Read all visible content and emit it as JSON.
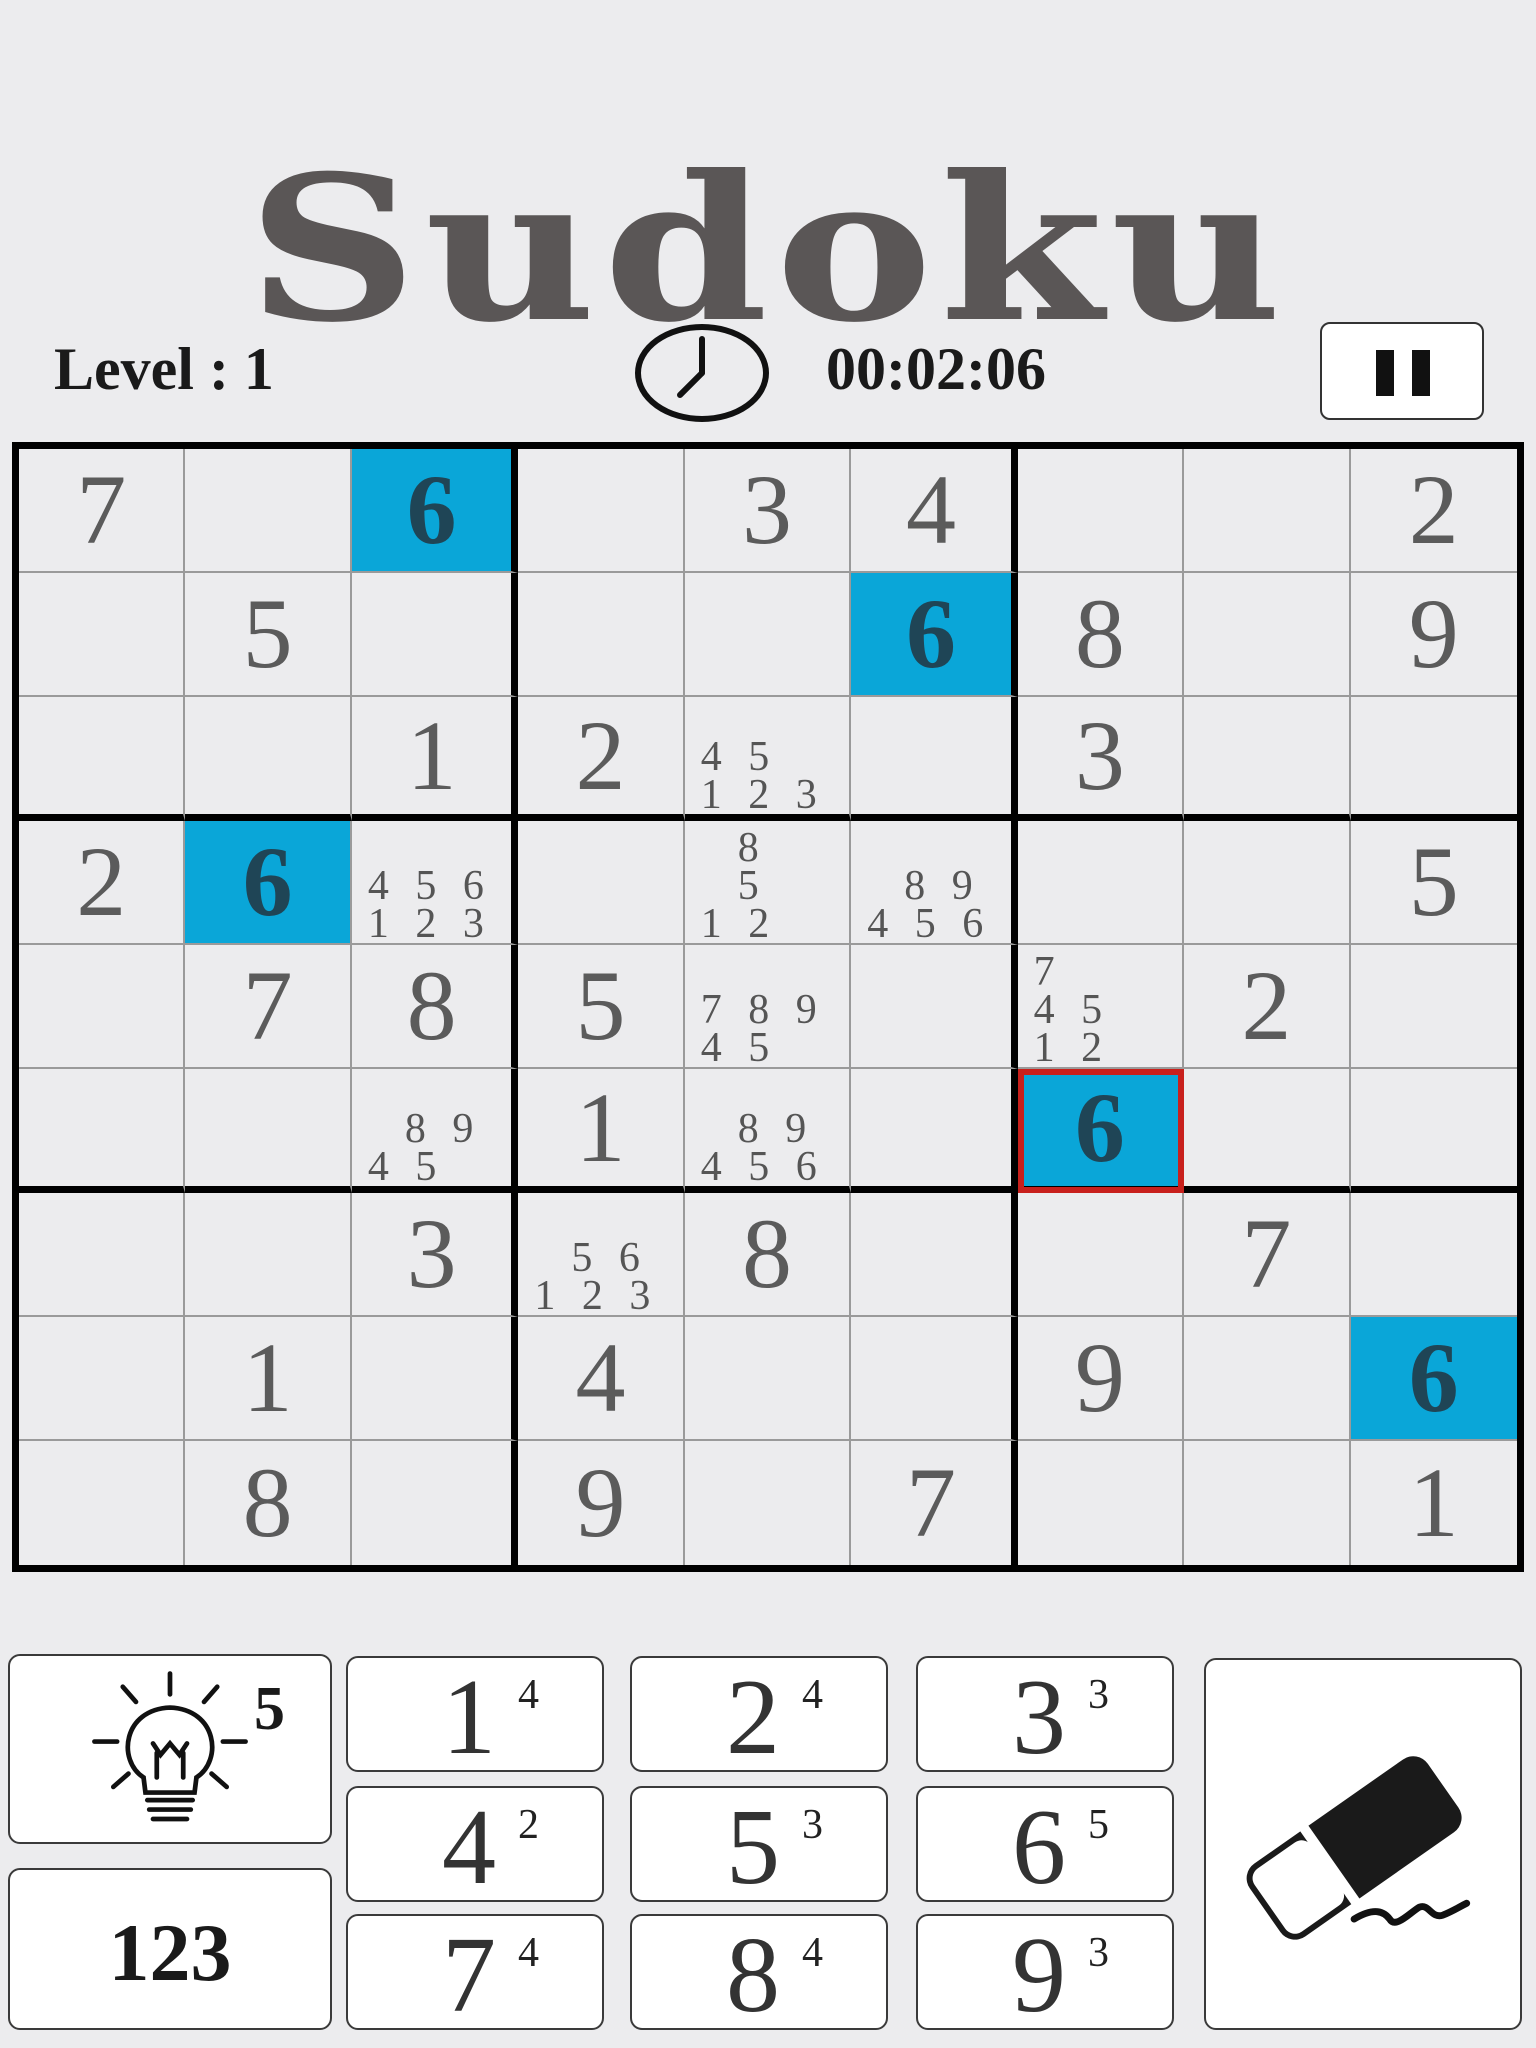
{
  "title": "Sudoku",
  "level_text": "Level : 1",
  "timer": "00:02:06",
  "icons": {
    "clock": "clock-icon",
    "pause": "pause-icon",
    "hint": "lightbulb-icon",
    "erase": "eraser-icon"
  },
  "colors": {
    "highlight": "#0aa6d8",
    "selected_border": "#c8201c",
    "title": "#5a5656"
  },
  "board": {
    "values": [
      [
        "7",
        "",
        "6",
        "",
        "3",
        "4",
        "",
        "",
        "2"
      ],
      [
        "",
        "5",
        "",
        "",
        "",
        "6",
        "8",
        "",
        "9"
      ],
      [
        "",
        "",
        "1",
        "2",
        "",
        "",
        "3",
        "",
        ""
      ],
      [
        "2",
        "6",
        "",
        "",
        "",
        "",
        "",
        "",
        "5"
      ],
      [
        "",
        "7",
        "8",
        "5",
        "",
        "",
        "",
        "2",
        ""
      ],
      [
        "",
        "",
        "",
        "1",
        "",
        "",
        "6",
        "",
        ""
      ],
      [
        "",
        "",
        "3",
        "",
        "8",
        "",
        "",
        "7",
        ""
      ],
      [
        "",
        "1",
        "",
        "4",
        "",
        "",
        "9",
        "",
        "6"
      ],
      [
        "",
        "8",
        "",
        "9",
        "",
        "7",
        "",
        "",
        "1"
      ]
    ],
    "highlighted": [
      [
        0,
        2
      ],
      [
        1,
        5
      ],
      [
        3,
        1
      ],
      [
        5,
        6
      ],
      [
        7,
        8
      ]
    ],
    "selected": [
      5,
      6
    ],
    "notes": [
      {
        "r": 2,
        "c": 4,
        "lines": [
          "4 5",
          "1 2 3"
        ]
      },
      {
        "r": 3,
        "c": 2,
        "lines": [
          "4 5 6",
          "1 2 3"
        ]
      },
      {
        "r": 3,
        "c": 4,
        "lines": [
          "  8",
          "  5",
          "1 2"
        ]
      },
      {
        "r": 3,
        "c": 5,
        "lines": [
          "  8 9",
          "4 5 6"
        ]
      },
      {
        "r": 4,
        "c": 4,
        "lines": [
          "7 8 9",
          "4 5"
        ]
      },
      {
        "r": 4,
        "c": 6,
        "lines": [
          "7",
          "4 5",
          "1 2"
        ]
      },
      {
        "r": 5,
        "c": 2,
        "lines": [
          "  8 9",
          "4 5"
        ]
      },
      {
        "r": 5,
        "c": 4,
        "lines": [
          "  8 9",
          "4 5 6"
        ]
      },
      {
        "r": 6,
        "c": 3,
        "lines": [
          "  5 6",
          "1 2 3"
        ]
      }
    ]
  },
  "hint": {
    "count": "5"
  },
  "mode_label": "123",
  "keypad": [
    {
      "digit": "1",
      "count": "4"
    },
    {
      "digit": "2",
      "count": "4"
    },
    {
      "digit": "3",
      "count": "3"
    },
    {
      "digit": "4",
      "count": "2"
    },
    {
      "digit": "5",
      "count": "3"
    },
    {
      "digit": "6",
      "count": "5"
    },
    {
      "digit": "7",
      "count": "4"
    },
    {
      "digit": "8",
      "count": "4"
    },
    {
      "digit": "9",
      "count": "3"
    }
  ]
}
